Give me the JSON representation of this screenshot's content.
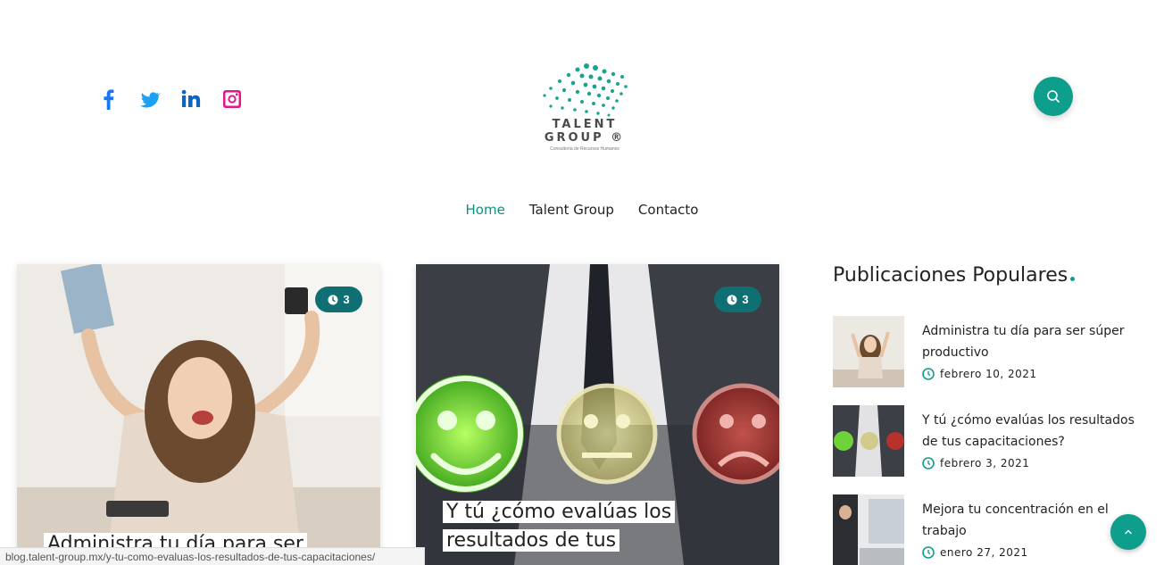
{
  "header": {
    "social": [
      {
        "name": "facebook-icon",
        "color": "#1877f2"
      },
      {
        "name": "twitter-icon",
        "color": "#1da1f2"
      },
      {
        "name": "linkedin-icon",
        "color": "#0a66c2"
      },
      {
        "name": "instagram-icon",
        "color": "#e4168f"
      }
    ],
    "logo": {
      "line1": "TALENT",
      "line2": "GROUP ®",
      "tagline": "Consultoría de Recursos Humanos"
    },
    "search_icon": "search-icon"
  },
  "nav": {
    "items": [
      "Home",
      "Talent Group",
      "Contacto"
    ],
    "active": "Home"
  },
  "posts": [
    {
      "title": "Administra tu día para ser súper",
      "reading_time": "3"
    },
    {
      "title": "Y tú ¿cómo evalúas los resultados de tus",
      "reading_time": "3"
    }
  ],
  "sidebar": {
    "heading": "Publicaciones Populares",
    "items": [
      {
        "title": "Administra tu día para ser súper productivo",
        "date": "febrero 10, 2021"
      },
      {
        "title": "Y tú ¿cómo evalúas los resultados de tus capacitaciones?",
        "date": "febrero 3, 2021"
      },
      {
        "title": "Mejora tu concentración en el trabajo",
        "date": "enero 27, 2021"
      }
    ]
  },
  "status_url": "blog.talent-group.mx/y-tu-como-evaluas-los-resultados-de-tus-capacitaciones/",
  "colors": {
    "accent": "#0e9e8c",
    "badge": "#0f6f72",
    "nav_active": "#0e8f80"
  }
}
